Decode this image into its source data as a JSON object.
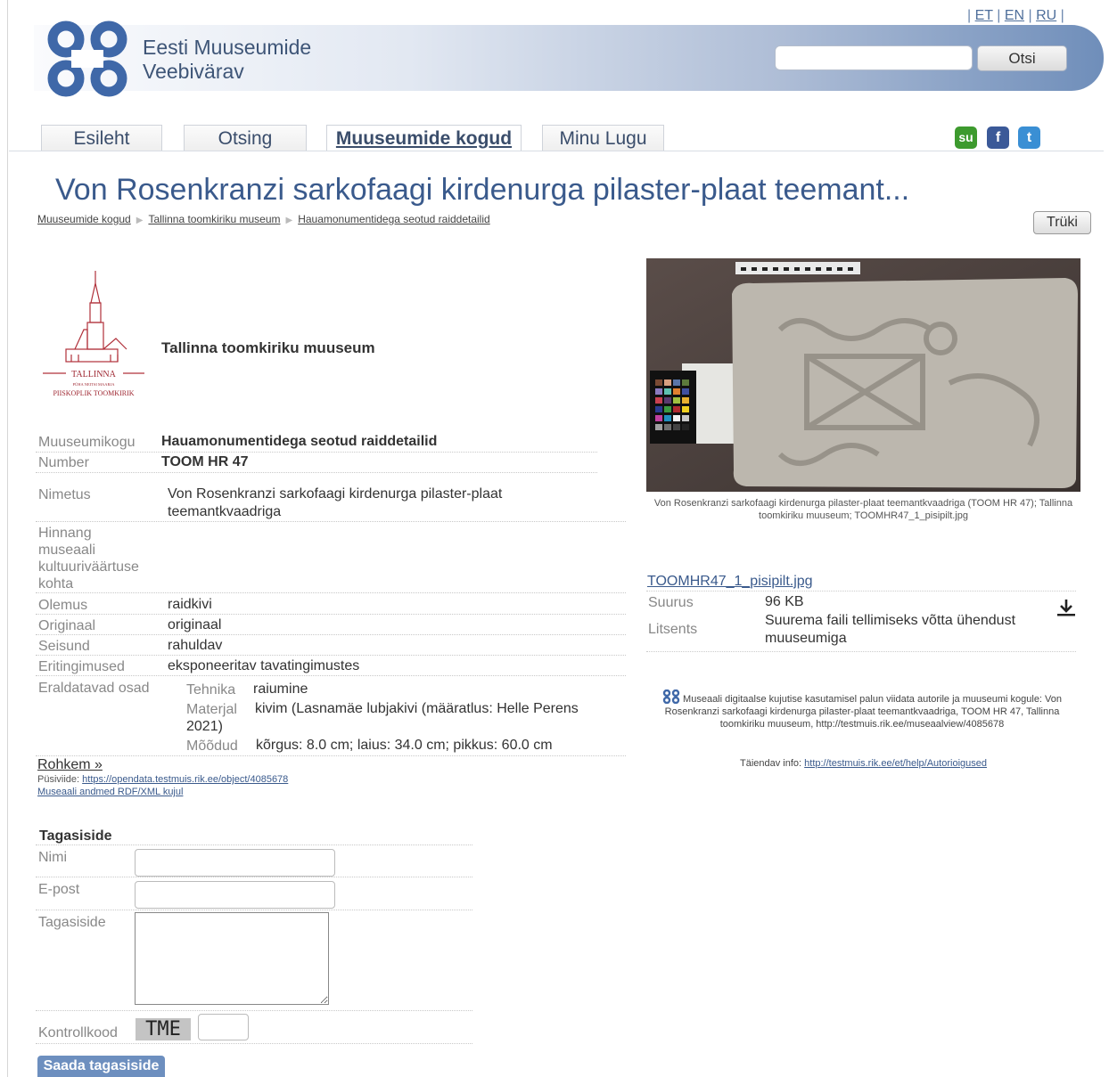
{
  "header": {
    "languages": [
      "ET",
      "EN",
      "RU"
    ],
    "site_title_line1": "Eesti Muuseumide",
    "site_title_line2": "Veebivärav",
    "search_placeholder": "",
    "search_button": "Otsi"
  },
  "nav": {
    "tabs": [
      {
        "label": "Esileht"
      },
      {
        "label": "Otsing"
      },
      {
        "label": "Muuseumide kogud",
        "active": true
      },
      {
        "label": "Minu Lugu"
      }
    ],
    "social_icons": [
      "stumbleupon-icon",
      "facebook-icon",
      "twitter-icon"
    ]
  },
  "page": {
    "title": "Von Rosenkranzi sarkofaagi kirdenurga pilaster-plaat teemant...",
    "breadcrumb": [
      "Muuseumide kogud",
      "Tallinna toomkiriku museum",
      "Hauamonumentidega seotud raiddetailid"
    ],
    "print_button": "Trüki"
  },
  "museum": {
    "logo_line1": "TALLINNA",
    "logo_line2": "PÜHA NEITSI MAARJA",
    "logo_line3": "PIISKOPLIK TOOMKIRIK",
    "name": "Tallinna toomkiriku muuseum"
  },
  "details": {
    "collection_label": "Muuseumikogu",
    "collection_value": "Hauamonumentidega seotud raiddetailid",
    "number_label": "Number",
    "number_value": "TOOM HR 47",
    "name_label": "Nimetus",
    "name_value": "Von Rosenkranzi sarkofaagi kirdenurga pilaster-plaat teemantkvaadriga",
    "assessment_label": "Hinnang museaali kultuuriväärtuse kohta",
    "nature_label": "Olemus",
    "nature_value": "raidkivi",
    "original_label": "Originaal",
    "original_value": "originaal",
    "condition_label": "Seisund",
    "condition_value": "rahuldav",
    "conditions_label": "Eritingimused",
    "conditions_value": "eksponeeritav tavatingimustes",
    "parts_label": "Eraldatavad osad",
    "technique_label": "Tehnika",
    "technique_value": "raiumine",
    "material_label": "Materjal",
    "material_value": "kivim (Lasnamäe lubjakivi (määratlus: Helle Perens 2021)",
    "dimensions_label": "Mõõdud",
    "dimensions_value": "kõrgus: 8.0 cm; laius: 34.0 cm; pikkus: 60.0 cm",
    "more_link": "Rohkem »",
    "permalink_label": "Püsiviide:",
    "permalink_url": "https://opendata.testmuis.rik.ee/object/4085678",
    "rdf_link": "Museaali andmed RDF/XML kujul"
  },
  "feedback": {
    "heading": "Tagasiside",
    "name_label": "Nimi",
    "email_label": "E-post",
    "message_label": "Tagasiside",
    "captcha_label": "Kontrollkood",
    "captcha_code": "TME",
    "submit_button": "Saada tagasiside"
  },
  "media": {
    "caption": "Von Rosenkranzi sarkofaagi kirdenurga pilaster-plaat teemantkvaadriga (TOOM HR 47); Tallinna toomkiriku muuseum; TOOMHR47_1_pisipilt.jpg",
    "file_name": "TOOMHR47_1_pisipilt.jpg",
    "size_label": "Suurus",
    "size_value": "96 KB",
    "license_label": "Litsents",
    "license_value": "Suurema faili tellimiseks võtta ühendust muuseumiga",
    "rights_text": "Museaali digitaalse kujutise kasutamisel palun viidata autorile ja muuseumi kogule: Von Rosenkranzi sarkofaagi kirdenurga pilaster-plaat teemantkvaadriga, TOOM HR 47, Tallinna toomkiriku muuseum, http://testmuis.rik.ee/museaalview/4085678",
    "extra_info_label": "Täiendav info:",
    "extra_info_url": "http://testmuis.rik.ee/et/help/Autorioigused"
  },
  "colors": {
    "title_blue": "#3a5a8c",
    "button_blue": "#6d8fbf"
  }
}
